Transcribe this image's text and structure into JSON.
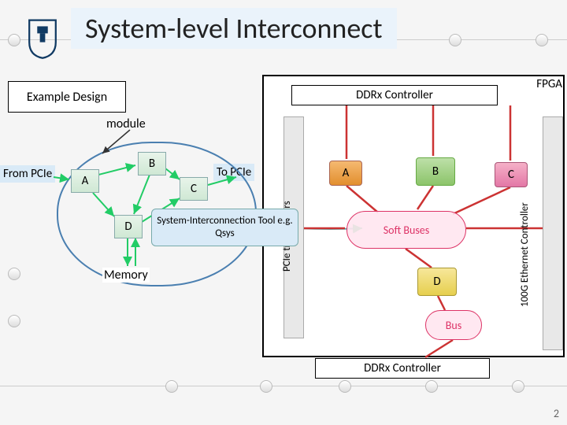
{
  "title": "System-level Interconnect",
  "example_label": "Example Design",
  "fpga_label": "FPGA",
  "ddr_label": "DDRx Controller",
  "module_label": "module",
  "from_pcie": "From PCIe",
  "to_pcie": "To PCIe",
  "memory_label": "Memory",
  "pcie_bar_label": "PCIe transceivers",
  "eth_bar_label": "100G Ethernet Controller",
  "soft_buses_label": "Soft Buses",
  "bus_label": "Bus",
  "qsys_label": "System-Interconnection Tool e.g. Qsys",
  "boxes": {
    "A": "A",
    "B": "B",
    "C": "C",
    "D": "D"
  },
  "right_chips": {
    "A": "A",
    "B": "B",
    "C": "C",
    "D": "D"
  },
  "slide_number": "2",
  "colors": {
    "title_bg": "#eaf3fb",
    "module_border": "#4a7fb0",
    "cloud_border": "#d36"
  }
}
